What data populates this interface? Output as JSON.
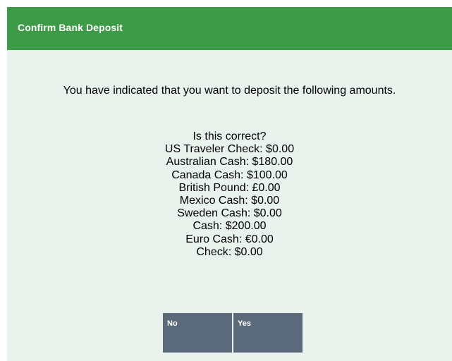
{
  "dialog": {
    "title": "Confirm Bank Deposit",
    "message": "You have indicated that you want to deposit the following amounts.",
    "question": "Is this correct?",
    "amounts": [
      "US Traveler Check: $0.00",
      "Australian Cash: $180.00",
      "Canada Cash: $100.00",
      "British Pound: £0.00",
      "Mexico Cash: $0.00",
      "Sweden Cash: $0.00",
      "Cash: $200.00",
      "Euro Cash: €0.00",
      "Check: $0.00"
    ],
    "buttons": {
      "no_label": "No",
      "yes_label": "Yes"
    }
  },
  "colors": {
    "titlebar": "#3d9a46",
    "background": "#e9f2ec",
    "button": "#5b6a7a"
  }
}
